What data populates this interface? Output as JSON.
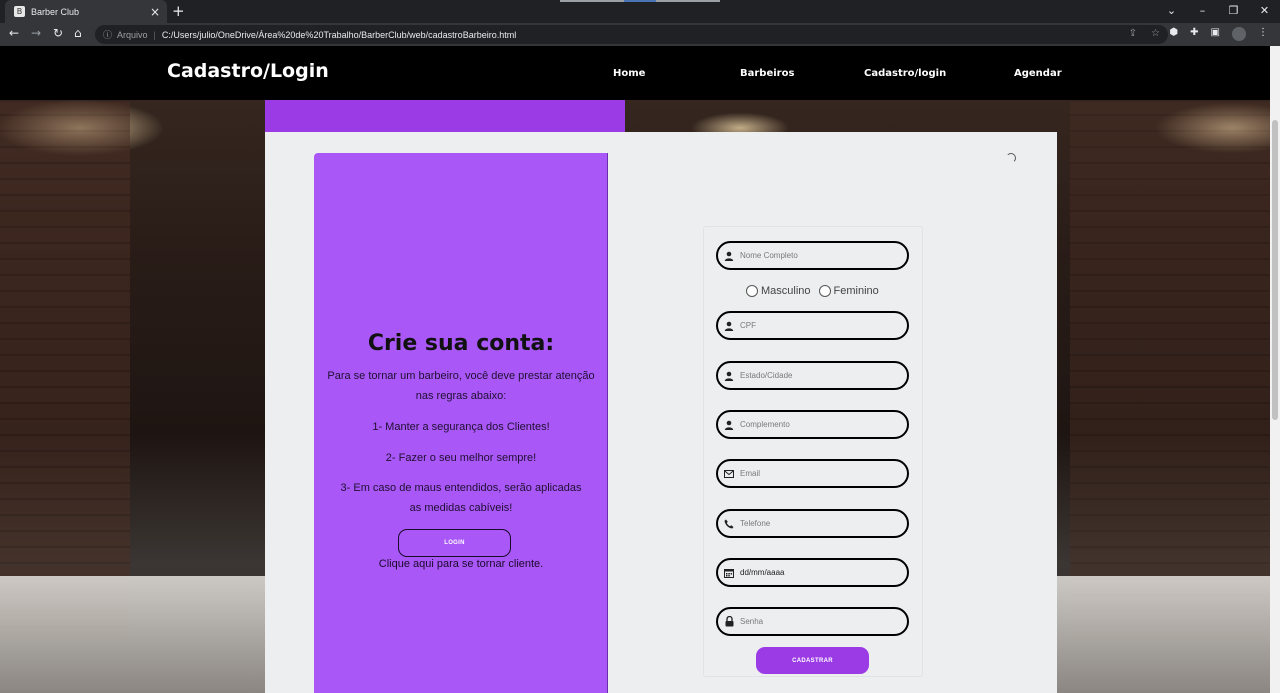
{
  "browser": {
    "tab_title": "Barber Club",
    "tab_favicon_letter": "B",
    "url_prefix": "Arquivo",
    "url": "C:/Users/julio/OneDrive/Área%20de%20Trabalho/BarberClub/web/cadastroBarbeiro.html"
  },
  "site": {
    "title": "Cadastro/Login",
    "nav": [
      "Home",
      "Barbeiros",
      "Cadastro/login",
      "Agendar"
    ]
  },
  "card": {
    "title": "Crie sua conta:",
    "intro": "Para se tornar um barbeiro, você deve prestar atenção nas regras abaixo:",
    "rule1": "1- Manter a segurança dos Clientes!",
    "rule2": "2- Fazer o seu melhor sempre!",
    "rule3": "3- Em caso de maus entendidos, serão aplicadas as medidas cabíveis!",
    "login_button": "LOGIN",
    "client_link": "Clique aqui para se tornar cliente."
  },
  "form": {
    "nome_placeholder": "Nome Completo",
    "gender_masculino": "Masculino",
    "gender_feminino": "Feminino",
    "cpf_placeholder": "CPF",
    "estado_placeholder": "Estado/Cidade",
    "complemento_placeholder": "Complemento",
    "email_placeholder": "Email",
    "telefone_placeholder": "Telefone",
    "date_value": "dd/mm/aaaa",
    "senha_placeholder": "Senha",
    "submit_button": "CADASTRAR"
  },
  "colors": {
    "accent_purple": "#9b3be6",
    "card_purple": "#a957f7",
    "panel_bg": "#eceeef"
  }
}
